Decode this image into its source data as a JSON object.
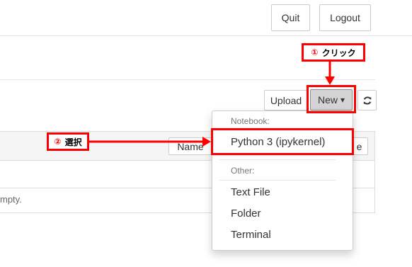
{
  "header": {
    "quit_label": "Quit",
    "logout_label": "Logout"
  },
  "toolbar": {
    "upload_label": "Upload",
    "new_label": "New",
    "new_caret": "▾",
    "refresh_icon": "refresh-icon"
  },
  "list": {
    "name_sort_label": "Name",
    "right_button_label": "e",
    "empty_text": "mpty."
  },
  "new_menu": {
    "notebook_header": "Notebook:",
    "python3_label": "Python 3 (ipykernel)",
    "other_header": "Other:",
    "text_file_label": "Text File",
    "folder_label": "Folder",
    "terminal_label": "Terminal"
  },
  "annotations": {
    "step1_number": "①",
    "step1_text": "クリック",
    "step2_number": "②",
    "step2_text": "選択",
    "highlight_color": "#ff0000"
  }
}
